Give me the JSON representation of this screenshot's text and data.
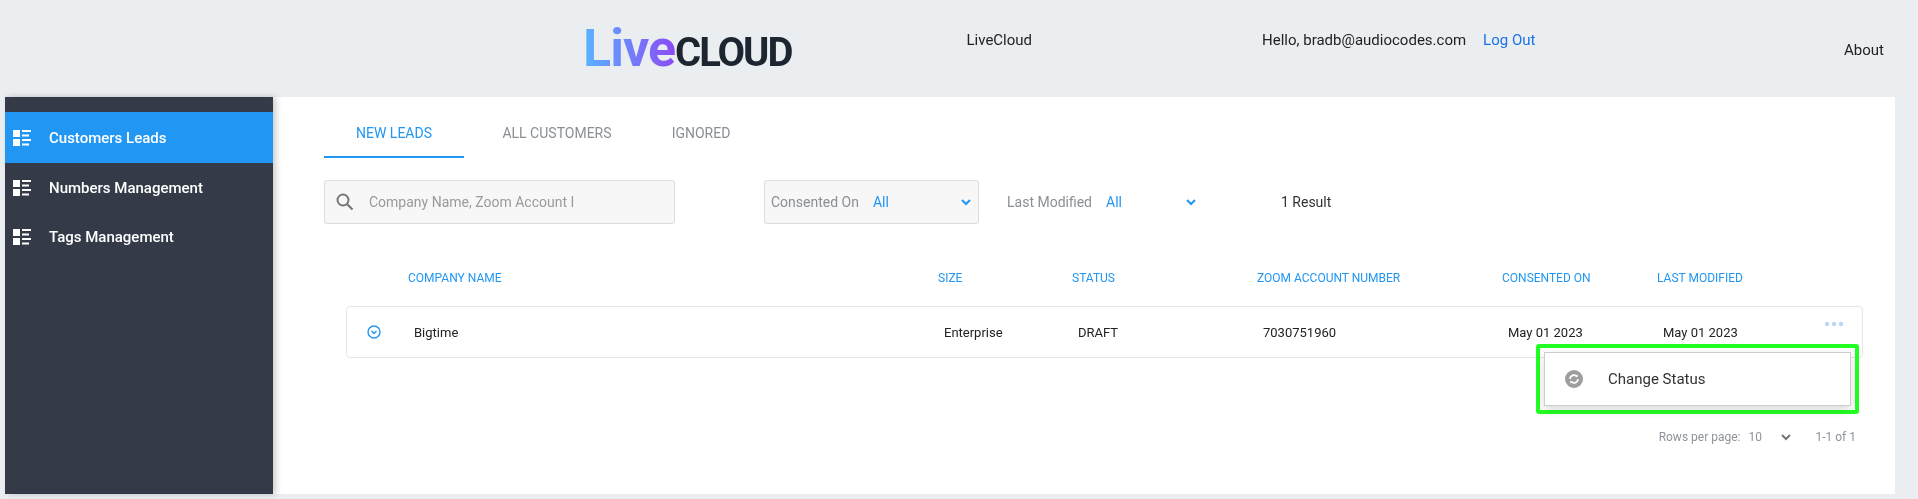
{
  "header": {
    "logo": [
      "Live",
      "CLOUD"
    ],
    "app_name": "LiveCloud",
    "greeting": "Hello, bradb@audiocodes.com",
    "logout": "Log Out",
    "about": "About"
  },
  "sidebar": {
    "items": [
      {
        "label": "Customers Leads",
        "selected": true
      },
      {
        "label": "Numbers Management",
        "selected": false
      },
      {
        "label": "Tags Management",
        "selected": false
      }
    ]
  },
  "tabs": [
    {
      "label": "NEW LEADS",
      "selected": true
    },
    {
      "label": "ALL CUSTOMERS",
      "selected": false
    },
    {
      "label": "IGNORED",
      "selected": false
    }
  ],
  "filters": {
    "search": {
      "placeholder": "Company Name, Zoom Account I"
    },
    "consented_on": {
      "label": "Consented On",
      "value": "All"
    },
    "last_modified": {
      "label": "Last Modified",
      "value": "All"
    },
    "result_count": "1 Result"
  },
  "table": {
    "columns": [
      "COMPANY NAME",
      "SIZE",
      "STATUS",
      "ZOOM ACCOUNT NUMBER",
      "CONSENTED ON",
      "LAST MODIFIED"
    ],
    "rows": [
      {
        "expanded": false,
        "cells": [
          "Bigtime",
          "Enterprise",
          "DRAFT",
          "7030751960",
          "May 01 2023",
          "May 01 2023"
        ]
      }
    ]
  },
  "row_menu": {
    "items": [
      {
        "label": "Change Status"
      }
    ]
  },
  "pagination": {
    "rows_per_page_label": "Rows per page:",
    "rows_per_page": "10",
    "range": "1-1 of 1"
  }
}
